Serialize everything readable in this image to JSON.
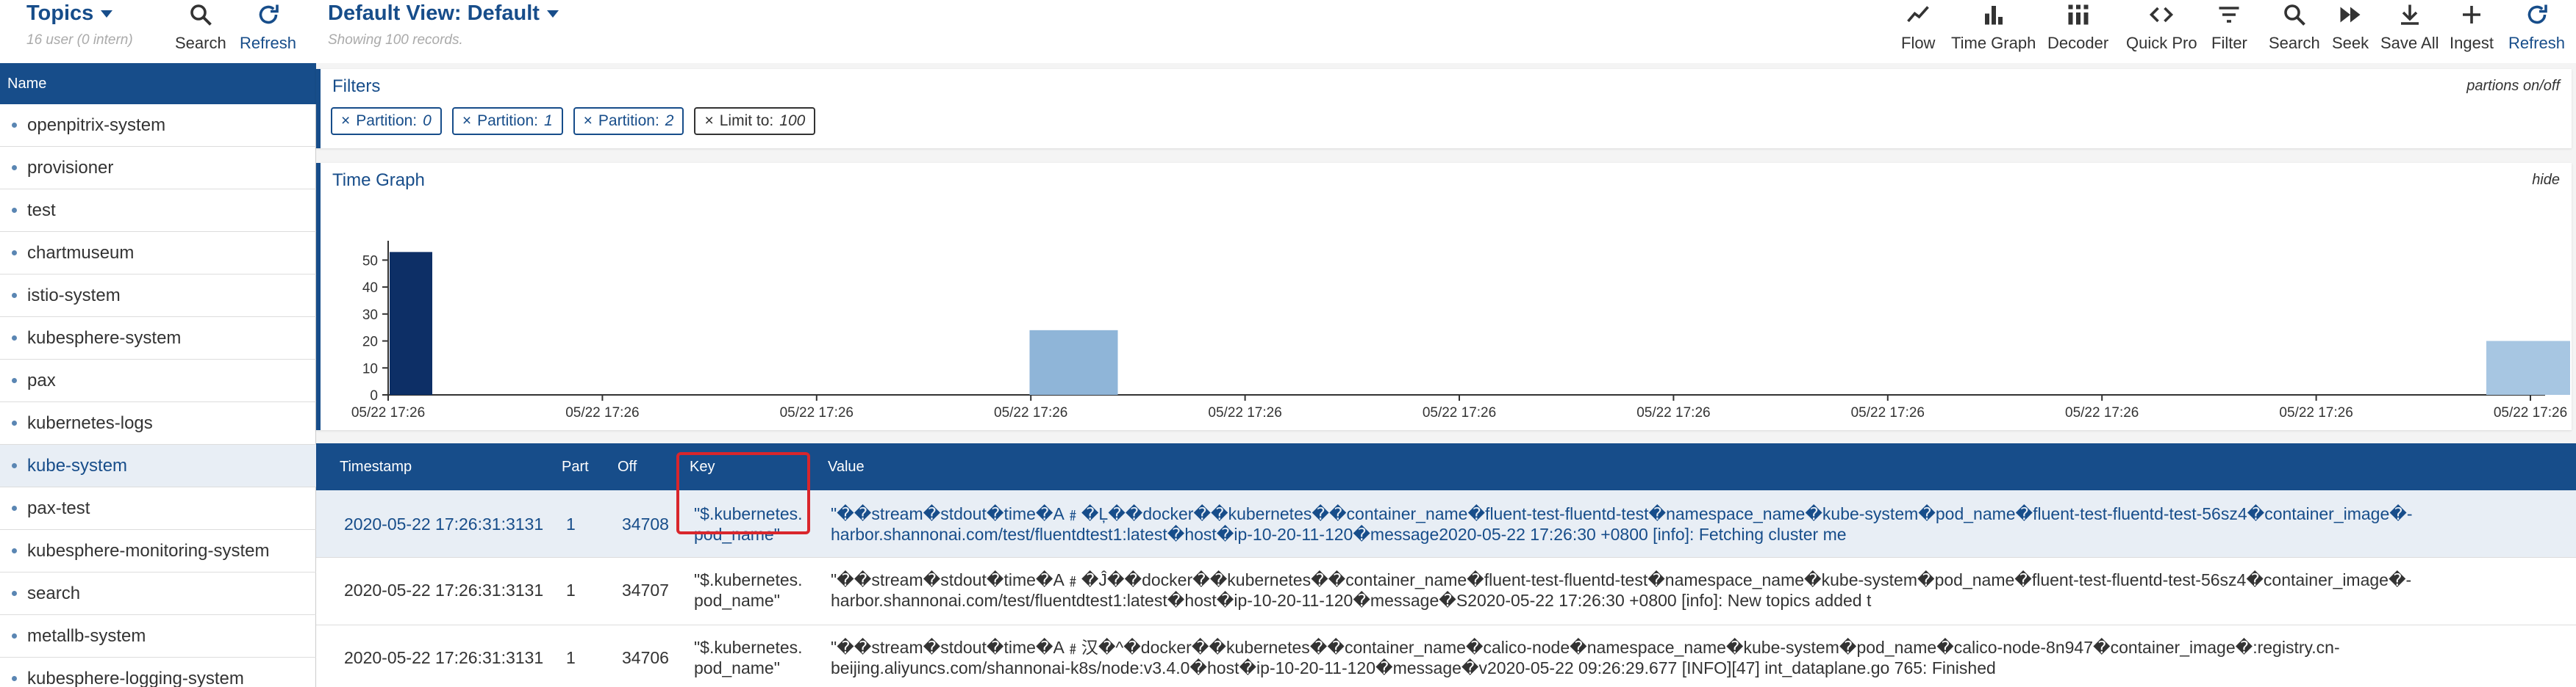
{
  "sidebar": {
    "title": "Topics",
    "subtitle": "16 user (0 intern)",
    "search_label": "Search",
    "refresh_label": "Refresh",
    "column_header": "Name",
    "items": [
      {
        "label": "openpitrix-system"
      },
      {
        "label": "provisioner"
      },
      {
        "label": "test"
      },
      {
        "label": "chartmuseum"
      },
      {
        "label": "istio-system"
      },
      {
        "label": "kubesphere-system"
      },
      {
        "label": "pax"
      },
      {
        "label": "kubernetes-logs"
      },
      {
        "label": "kube-system"
      },
      {
        "label": "pax-test"
      },
      {
        "label": "kubesphere-monitoring-system"
      },
      {
        "label": "search"
      },
      {
        "label": "metallb-system"
      },
      {
        "label": "kubesphere-logging-system"
      }
    ],
    "active_item": "kube-system"
  },
  "header": {
    "view_title": "Default View: Default",
    "view_subtitle": "Showing 100 records.",
    "toolbar": [
      {
        "label": "Flow",
        "icon": "flow-icon"
      },
      {
        "label": "Time Graph",
        "icon": "bar-chart-icon"
      },
      {
        "label": "Decoder",
        "icon": "decoder-icon"
      },
      {
        "label": "Quick Pro",
        "icon": "code-icon"
      },
      {
        "label": "Filter",
        "icon": "filter-icon"
      },
      {
        "label": "Search",
        "icon": "search-icon"
      },
      {
        "label": "Seek",
        "icon": "fast-forward-icon"
      },
      {
        "label": "Save All",
        "icon": "download-icon"
      },
      {
        "label": "Ingest",
        "icon": "plus-icon"
      },
      {
        "label": "Refresh",
        "icon": "refresh-icon"
      }
    ]
  },
  "filters": {
    "title": "Filters",
    "right_label": "partions on/off",
    "chips": [
      {
        "x": "×",
        "label": "Partition:",
        "value": "0"
      },
      {
        "x": "×",
        "label": "Partition:",
        "value": "1"
      },
      {
        "x": "×",
        "label": "Partition:",
        "value": "2"
      },
      {
        "x": "×",
        "label": "Limit to:",
        "value": "100"
      }
    ]
  },
  "time_graph": {
    "title": "Time Graph",
    "right_label": "hide"
  },
  "chart_data": {
    "type": "bar",
    "y_ticks": [
      "0",
      "10",
      "20",
      "30",
      "40",
      "50"
    ],
    "ylim": [
      0,
      55
    ],
    "x_ticks": [
      "05/22 17:26",
      "05/22 17:26",
      "05/22 17:26",
      "05/22 17:26",
      "05/22 17:26",
      "05/22 17:26",
      "05/22 17:26",
      "05/22 17:26",
      "05/22 17:26",
      "05/22 17:26",
      "05/22 17:26"
    ],
    "bars": [
      {
        "x_index": 0,
        "value": 53,
        "color": "#0d2f66"
      },
      {
        "x_index": 3.2,
        "value": 24,
        "color": "#8fb5d8"
      },
      {
        "x_index": 10,
        "value": 20,
        "color": "#a7c6e2"
      }
    ],
    "colors": {
      "dark": "#0d2f66",
      "light": "#8fb5d8"
    }
  },
  "table": {
    "columns": [
      "Timestamp",
      "Part",
      "Off",
      "Key",
      "Value"
    ],
    "rows": [
      {
        "timestamp": "2020-05-22 17:26:31:3131",
        "part": "1",
        "offset": "34708",
        "key1": "\"$.kubernetes.",
        "key2": "pod_name\"",
        "value1": "\"��stream�stdout�time�A﹟�Ļ��docker��kubernetes��container_name�fluent-test-fluentd-test�namespace_name�kube-system�pod_name�fluent-test-fluentd-test-56sz4�container_image�-",
        "value2": "harbor.shannonai.com/test/fluentdtest1:latest�host�ip-10-20-11-120�message2020-05-22 17:26:30 +0800 [info]: Fetching cluster me"
      },
      {
        "timestamp": "2020-05-22 17:26:31:3131",
        "part": "1",
        "offset": "34707",
        "key1": "\"$.kubernetes.",
        "key2": "pod_name\"",
        "value1": "\"��stream�stdout�time�A﹟�Ĵ��docker��kubernetes��container_name�fluent-test-fluentd-test�namespace_name�kube-system�pod_name�fluent-test-fluentd-test-56sz4�container_image�-",
        "value2": "harbor.shannonai.com/test/fluentdtest1:latest�host�ip-10-20-11-120�message�S2020-05-22 17:26:30 +0800 [info]: New topics added t"
      },
      {
        "timestamp": "2020-05-22 17:26:31:3131",
        "part": "1",
        "offset": "34706",
        "key1": "\"$.kubernetes.",
        "key2": "pod_name\"",
        "value1": "\"��stream�stdout�time�A﹟汉�^�docker��kubernetes��container_name�calico-node�namespace_name�kube-system�pod_name�calico-node-8n947�container_image�:registry.cn-",
        "value2": "beijing.aliyuncs.com/shannonai-k8s/node:v3.4.0�host�ip-10-20-11-120�message�v2020-05-22 09:26:29.677 [INFO][47] int_dataplane.go 765: Finished"
      }
    ]
  }
}
